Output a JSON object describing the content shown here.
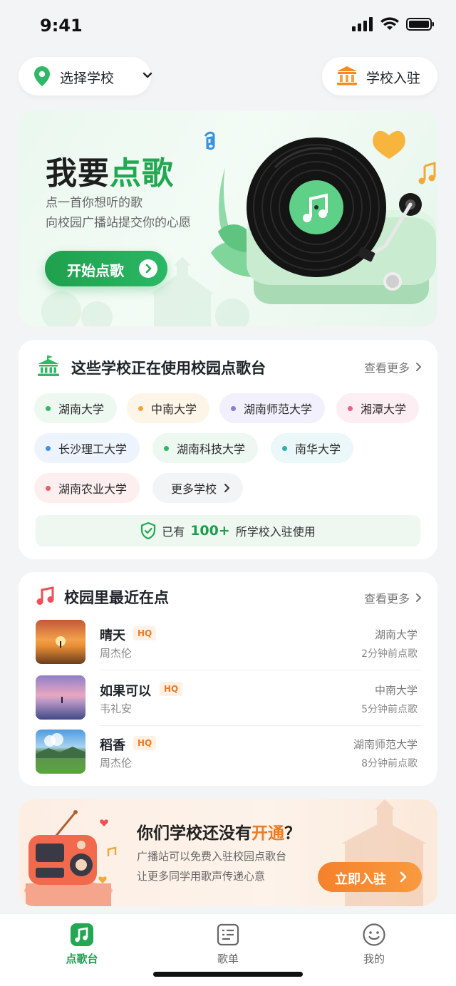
{
  "status_bar": {
    "time": "9:41"
  },
  "header": {
    "school_select_label": "选择学校",
    "join_label": "学校入驻"
  },
  "hero": {
    "title_part1": "我要",
    "title_part2": "点歌",
    "subtitle_line1": "点一首你想听的歌",
    "subtitle_line2": "向校园广播站提交你的心愿",
    "button_label": "开始点歌"
  },
  "schools": {
    "title": "这些学校正在使用校园点歌台",
    "more_label": "查看更多",
    "chips": [
      {
        "label": "湖南大学",
        "dot": "#2fb865",
        "bg": "#ecf8f0"
      },
      {
        "label": "中南大学",
        "dot": "#f2a43a",
        "bg": "#fdf5e8"
      },
      {
        "label": "湖南师范大学",
        "dot": "#8b7be0",
        "bg": "#f2f0fc"
      },
      {
        "label": "湘潭大学",
        "dot": "#ec5f8e",
        "bg": "#fdeef3"
      },
      {
        "label": "长沙理工大学",
        "dot": "#3f8fe6",
        "bg": "#edf4fd"
      },
      {
        "label": "湖南科技大学",
        "dot": "#2fb865",
        "bg": "#ecf8f0"
      },
      {
        "label": "南华大学",
        "dot": "#2fb0b0",
        "bg": "#ebf7f8"
      },
      {
        "label": "湖南农业大学",
        "dot": "#ec5f5f",
        "bg": "#fdefef"
      }
    ],
    "more_schools_label": "更多学校",
    "stat_prefix": "已有",
    "stat_number": "100+",
    "stat_suffix": "所学校入驻使用"
  },
  "recent": {
    "title": "校园里最近在点",
    "more_label": "查看更多",
    "songs": [
      {
        "name": "晴天",
        "badge": "HQ",
        "artist": "周杰伦",
        "school": "湖南大学",
        "time": "2分钟前点歌"
      },
      {
        "name": "如果可以",
        "badge": "HQ",
        "artist": "韦礼安",
        "school": "中南大学",
        "time": "5分钟前点歌"
      },
      {
        "name": "稻香",
        "badge": "HQ",
        "artist": "周杰伦",
        "school": "湖南师范大学",
        "time": "8分钟前点歌"
      }
    ]
  },
  "promo": {
    "title_part1": "你们学校还没有",
    "title_highlight": "开通",
    "title_part2": "？",
    "line1": "广播站可以免费入驻校园点歌台",
    "line2": "让更多同学用歌声传递心意",
    "button_label": "立即入驻"
  },
  "tabbar": {
    "items": [
      {
        "label": "点歌台",
        "icon": "music-note-icon",
        "active": true
      },
      {
        "label": "歌单",
        "icon": "playlist-icon",
        "active": false
      },
      {
        "label": "我的",
        "icon": "smiley-icon",
        "active": false
      }
    ]
  },
  "colors": {
    "brand_green": "#22a853",
    "accent_orange": "#f07a1f"
  }
}
